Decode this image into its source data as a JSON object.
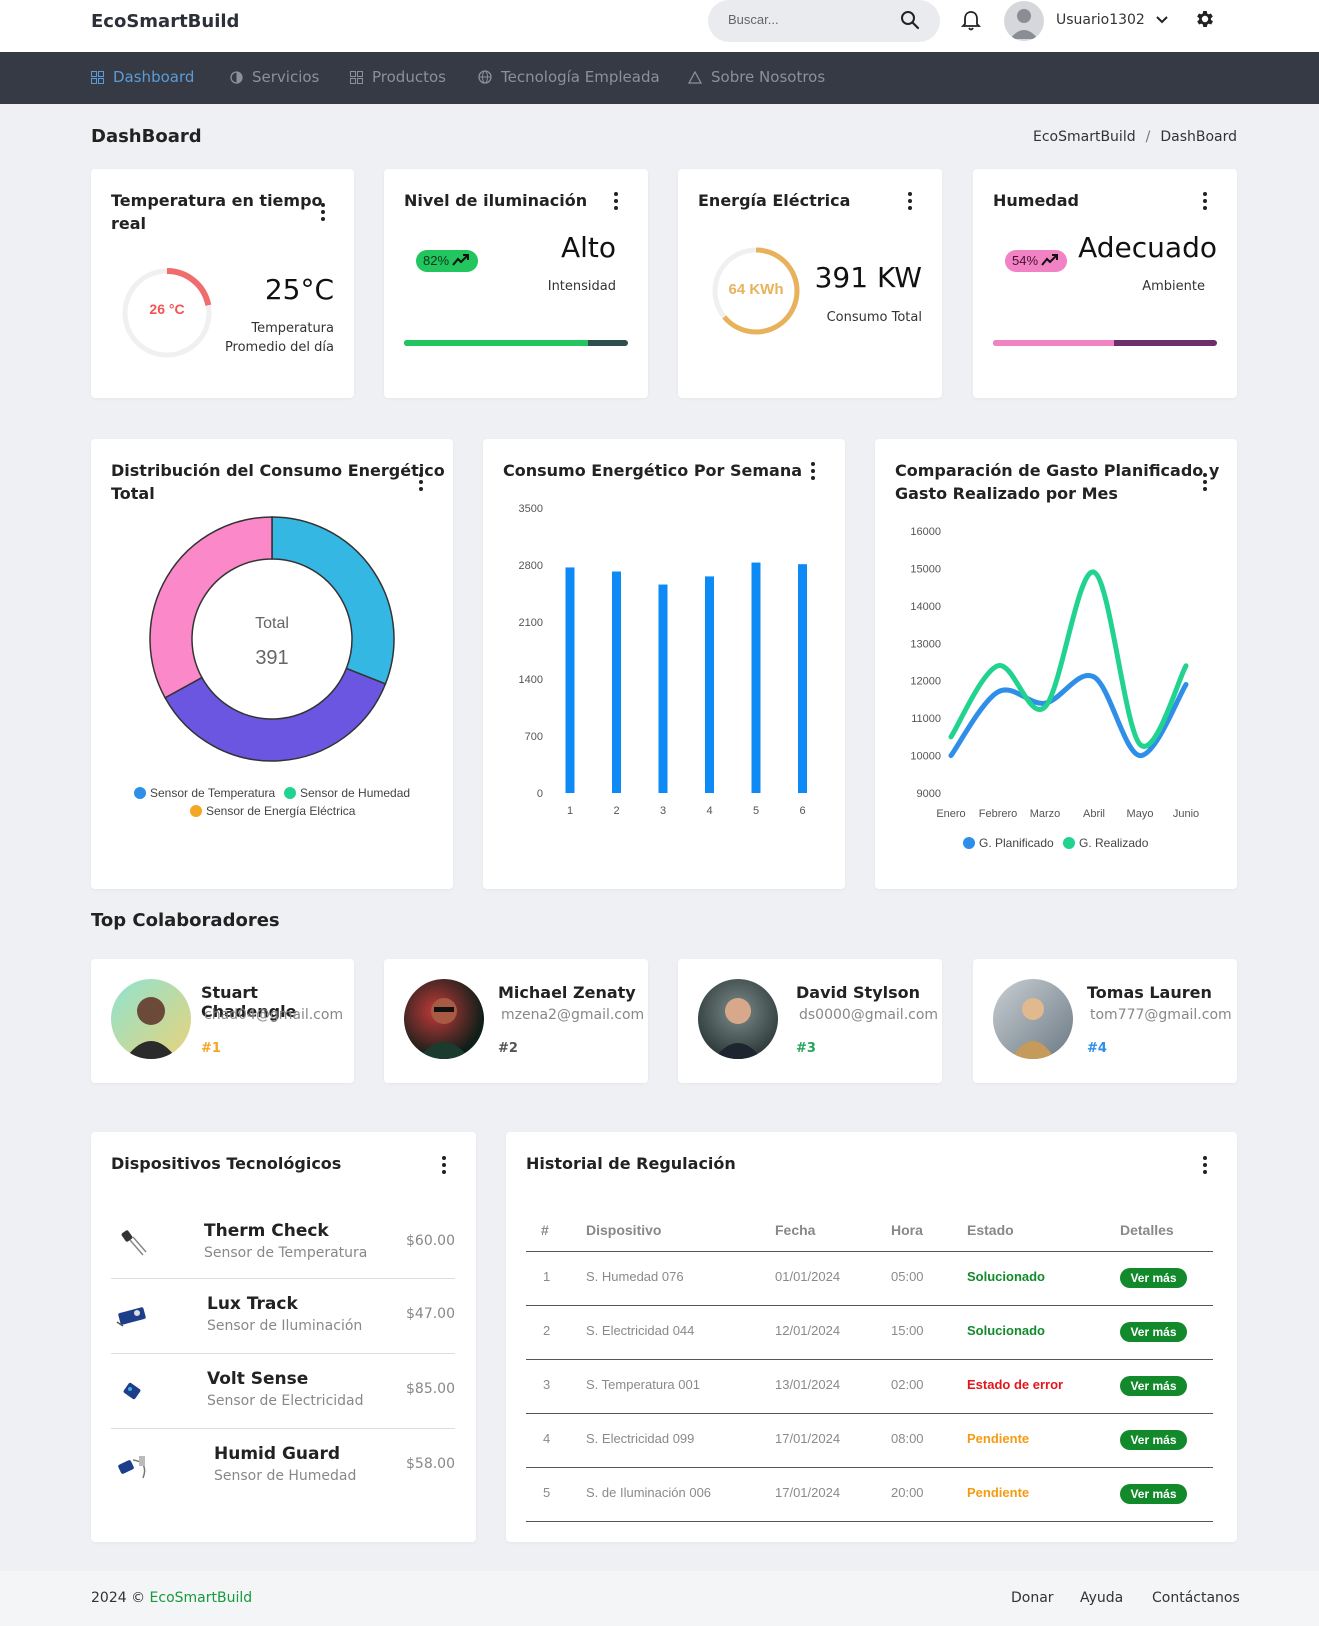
{
  "header": {
    "brand": "EcoSmartBuild",
    "search_placeholder": "Buscar...",
    "username": "Usuario1302"
  },
  "nav": {
    "items": [
      {
        "label": "Dashboard",
        "icon": "grid-icon",
        "active": true
      },
      {
        "label": "Servicios",
        "icon": "half-circle-icon"
      },
      {
        "label": "Productos",
        "icon": "grid-icon"
      },
      {
        "label": "Tecnología Empleada",
        "icon": "globe-icon"
      },
      {
        "label": "Sobre Nosotros",
        "icon": "triangle-icon"
      }
    ]
  },
  "page": {
    "title": "DashBoard",
    "breadcrumb": [
      "EcoSmartBuild",
      "/",
      "DashBoard"
    ]
  },
  "stats": {
    "temperature": {
      "title_line1": "Temperatura en tiempo",
      "title_line2": "real",
      "gauge_label": "26 °C",
      "gauge_fraction": 0.22,
      "value": "25°C",
      "sub_line1": "Temperatura",
      "sub_line2": "Promedio del día",
      "color": "#f16d6d"
    },
    "lighting": {
      "title": "Nivel de iluminación",
      "pill": "82%",
      "value": "Alto",
      "sub": "Intensidad",
      "progress": 0.82,
      "color": "#22c55e",
      "track": "#2f4f4f"
    },
    "energy": {
      "title": "Energía Eléctrica",
      "gauge_label": "64 KWh",
      "gauge_fraction": 0.64,
      "value": "391 KW",
      "sub": "Consumo Total",
      "color": "#e8b25c"
    },
    "humidity": {
      "title": "Humedad",
      "pill": "54%",
      "value": "Adecuado",
      "sub": "Ambiente",
      "progress": 0.54,
      "color": "#f182c4",
      "track": "#6b2f6b"
    }
  },
  "charts": {
    "donut": {
      "title_line1": "Distribución del Consumo Energético",
      "title_line2": "Total",
      "center_label": "Total",
      "center_value": "391",
      "legend": [
        {
          "label": "Sensor de Temperatura",
          "color": "#2e8ee8"
        },
        {
          "label": "Sensor de Humedad",
          "color": "#21d38f"
        },
        {
          "label": "Sensor de Energía Eléctrica",
          "color": "#f5a623"
        }
      ]
    },
    "weekly": {
      "title": "Consumo Energético Por Semana"
    },
    "comparison": {
      "title_line1": "Comparación de Gasto Planificado y",
      "title_line2": "Gasto Realizado por Mes",
      "legend": [
        {
          "label": "G. Planificado",
          "color": "#2e8ee8"
        },
        {
          "label": "G. Realizado",
          "color": "#21d38f"
        }
      ]
    }
  },
  "chart_data": [
    {
      "type": "pie",
      "title": "Distribución del Consumo Energético Total",
      "slices": [
        {
          "name": "",
          "value": 0.31,
          "color": "#35b7e3"
        },
        {
          "name": "",
          "value": 0.36,
          "color": "#6a56e0"
        },
        {
          "name": "",
          "value": 0.33,
          "color": "#fb88c8"
        }
      ]
    },
    {
      "type": "bar",
      "title": "Consumo Energético Por Semana",
      "categories": [
        "1",
        "2",
        "3",
        "4",
        "5",
        "6"
      ],
      "values": [
        2770,
        2720,
        2560,
        2660,
        2830,
        2810
      ],
      "ylim": [
        0,
        3500
      ],
      "yticks": [
        "3500",
        "2800",
        "2100",
        "1400",
        "700",
        "0"
      ],
      "color": "#0d8af5"
    },
    {
      "type": "line",
      "title": "Comparación de Gasto Planificado y Gasto Realizado por Mes",
      "categories": [
        "Enero",
        "Febrero",
        "Marzo",
        "Abril",
        "Mayo",
        "Junio"
      ],
      "series": [
        {
          "name": "G. Planificado",
          "values": [
            10000,
            11700,
            11400,
            12100,
            10000,
            11900
          ],
          "color": "#2e8ee8"
        },
        {
          "name": "G. Realizado",
          "values": [
            10500,
            12400,
            11300,
            14900,
            10300,
            12400
          ],
          "color": "#21d38f"
        }
      ],
      "ylim": [
        9000,
        16000
      ],
      "yticks": [
        "16000",
        "15000",
        "14000",
        "13000",
        "12000",
        "11000",
        "10000",
        "9000"
      ]
    }
  ],
  "collaborators": {
    "title": "Top Colaboradores",
    "items": [
      {
        "name": "Stuart Chadengle",
        "email": "chad04@gmail.com",
        "rank": "#1",
        "rank_color": "#f5a623",
        "bg": "#7ec7c0"
      },
      {
        "name": "Michael Zenaty",
        "email": "mzena2@gmail.com",
        "rank": "#2",
        "rank_color": "#555555",
        "bg": "#1e3b2e"
      },
      {
        "name": "David Stylson",
        "email": "ds0000@gmail.com",
        "rank": "#3",
        "rank_color": "#22a55b",
        "bg": "#4a5a5a"
      },
      {
        "name": "Tomas Lauren",
        "email": "tom777@gmail.com",
        "rank": "#4",
        "rank_color": "#2e8ee8",
        "bg": "#a0a8b0"
      }
    ]
  },
  "devices": {
    "title": "Dispositivos Tecnológicos",
    "items": [
      {
        "name": "Therm Check",
        "sub": "Sensor de Temperatura",
        "price": "$60.00"
      },
      {
        "name": "Lux Track",
        "sub": "Sensor de Iluminación",
        "price": "$47.00"
      },
      {
        "name": "Volt Sense",
        "sub": "Sensor de Electricidad",
        "price": "$85.00"
      },
      {
        "name": "Humid Guard",
        "sub": "Sensor de Humedad",
        "price": "$58.00"
      }
    ]
  },
  "history": {
    "title": "Historial de Regulación",
    "headers": [
      "#",
      "Dispositivo",
      "Fecha",
      "Hora",
      "Estado",
      "Detalles"
    ],
    "rows": [
      {
        "n": "1",
        "device": "S. Humedad 076",
        "date": "01/01/2024",
        "time": "05:00",
        "status": "Solucionado",
        "status_color": "#128a2c",
        "action": "Ver más"
      },
      {
        "n": "2",
        "device": "S. Electricidad 044",
        "date": "12/01/2024",
        "time": "15:00",
        "status": "Solucionado",
        "status_color": "#128a2c",
        "action": "Ver más"
      },
      {
        "n": "3",
        "device": "S. Temperatura 001",
        "date": "13/01/2024",
        "time": "02:00",
        "status": "Estado de error",
        "status_color": "#e3161b",
        "action": "Ver más"
      },
      {
        "n": "4",
        "device": "S. Electricidad 099",
        "date": "17/01/2024",
        "time": "08:00",
        "status": "Pendiente",
        "status_color": "#f59b12",
        "action": "Ver más"
      },
      {
        "n": "5",
        "device": "S. de Iluminación 006",
        "date": "17/01/2024",
        "time": "20:00",
        "status": "Pendiente",
        "status_color": "#f59b12",
        "action": "Ver más"
      }
    ]
  },
  "footer": {
    "year": "2024 ©",
    "brand": "EcoSmartBuild",
    "links": [
      "Donar",
      "Ayuda",
      "Contáctanos"
    ]
  }
}
